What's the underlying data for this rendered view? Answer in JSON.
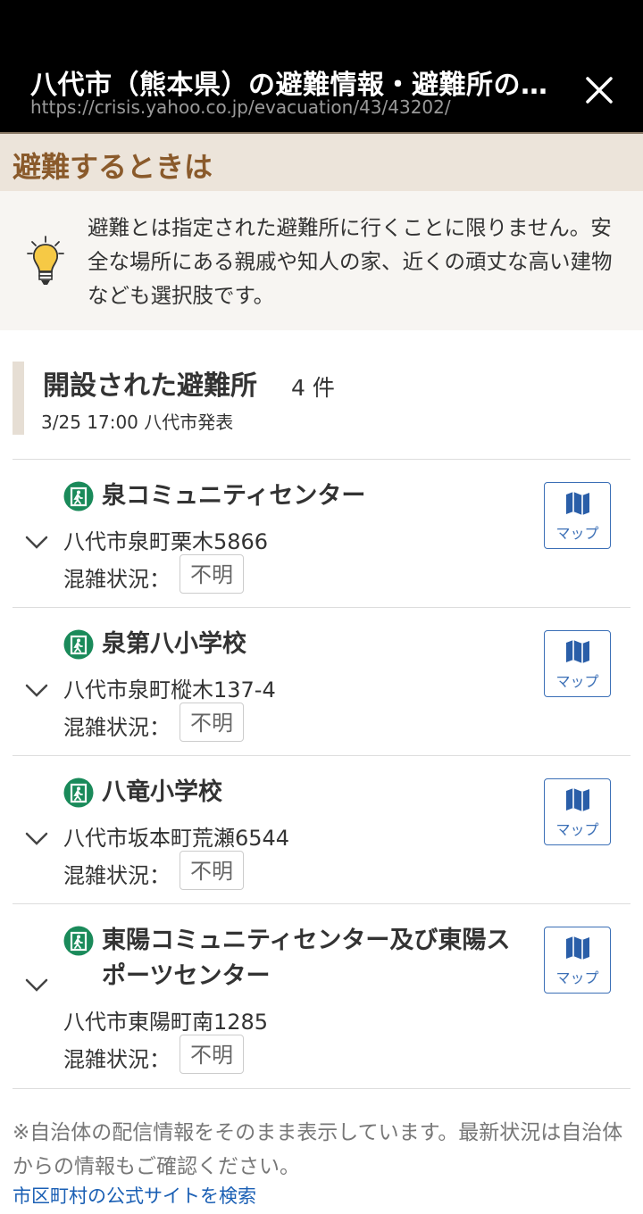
{
  "browser": {
    "title": "八代市（熊本県）の避難情報・避難所のご案内",
    "url": "https://crisis.yahoo.co.jp/evacuation/43/43202/"
  },
  "section_title": "避難するときは",
  "tip": "避難とは指定された避難所に行くことに限りません。安全な場所にある親戚や知人の家、近くの頑丈な高い建物なども選択肢です。",
  "shelters_header": {
    "title": "開設された避難所",
    "count": "4 件",
    "announced": "3/25 17:00 八代市発表"
  },
  "shelters": [
    {
      "name": "泉コミュニティセンター",
      "address": "八代市泉町栗木5866",
      "crowd_label": "混雑状況：",
      "crowd_value": "不明",
      "map_label": "マップ"
    },
    {
      "name": "泉第八小学校",
      "address": "八代市泉町樅木137-4",
      "crowd_label": "混雑状況：",
      "crowd_value": "不明",
      "map_label": "マップ"
    },
    {
      "name": "八竜小学校",
      "address": "八代市坂本町荒瀬6544",
      "crowd_label": "混雑状況：",
      "crowd_value": "不明",
      "map_label": "マップ"
    },
    {
      "name": "東陽コミュニティセンター及び東陽スポーツセンター",
      "address": "八代市東陽町南1285",
      "crowd_label": "混雑状況：",
      "crowd_value": "不明",
      "map_label": "マップ"
    }
  ],
  "notice": "※自治体の配信情報をそのまま表示しています。最新状況は自治体からの情報もご確認ください。",
  "search_link": "市区町村の公式サイトを検索",
  "icons": {
    "close": "close-icon",
    "tip": "lightbulb-icon",
    "shelter": "emergency-exit-icon",
    "expand": "chevron-down-icon",
    "map": "map-icon"
  },
  "colors": {
    "section_title": "#8a5a2b",
    "shelter_icon": "#1a8a5a",
    "link": "#1a5fb4"
  }
}
